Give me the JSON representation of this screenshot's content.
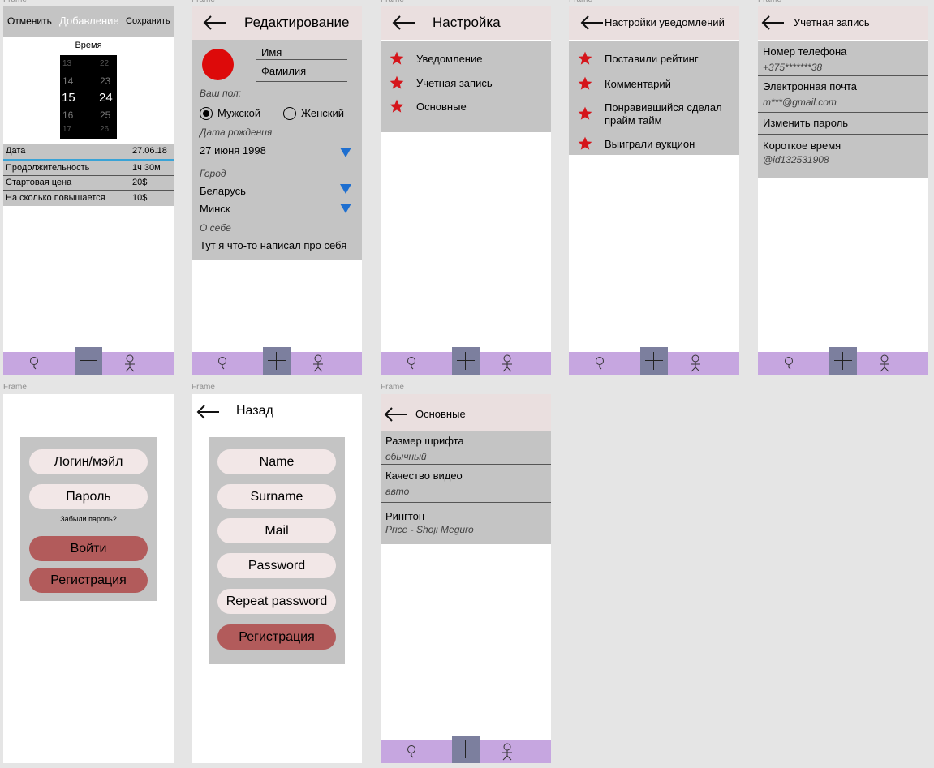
{
  "frame_label": "Frame",
  "add": {
    "cancel": "Отменить",
    "title": "Добавление",
    "save": "Сохранить",
    "time_label": "Время",
    "picker_hours": [
      "13",
      "14",
      "15",
      "16",
      "17"
    ],
    "picker_minutes": [
      "22",
      "23",
      "24",
      "25",
      "26"
    ],
    "rows": [
      {
        "label": "Дата",
        "value": "27.06.18"
      },
      {
        "label": "Продолжительность",
        "value": "1ч 30м"
      },
      {
        "label": "Стартовая цена",
        "value": "20$"
      },
      {
        "label": "На сколько  повышается",
        "value": "10$"
      }
    ]
  },
  "edit": {
    "title": "Редактирование",
    "first_name": "Имя",
    "last_name": "Фамилия",
    "gender_label": "Ваш пол:",
    "male": "Мужской",
    "female": "Женский",
    "birth_label": "Дата рождения",
    "birth_value": "27 июня 1998",
    "city_label": "Город",
    "country": "Беларусь",
    "city": "Минск",
    "about_label": "О себе",
    "about_value": "Тут я что-то написал про себя"
  },
  "settings": {
    "title": "Настройка",
    "items": [
      "Уведомление",
      "Учетная запись",
      "Основные"
    ]
  },
  "notifications": {
    "title": "Настройки уведомлений",
    "items": [
      "Поставили рейтинг",
      "Комментарий",
      "Понравившийся сделал прайм тайм",
      "Выиграли аукцион"
    ]
  },
  "account": {
    "title": "Учетная запись",
    "phone_label": "Номер телефона",
    "phone_value": "+375*******38",
    "email_label": "Электронная почта",
    "email_value": "m***@gmail.com",
    "change_password": "Изменить пароль",
    "short_label": "Короткое время",
    "short_value": "@id132531908"
  },
  "login": {
    "login_field": "Логин/мэйл",
    "password_field": "Пароль",
    "forgot": "Забыли пароль?",
    "login_button": "Войти",
    "register_button": "Регистрация"
  },
  "register": {
    "back": "Назад",
    "name": "Name",
    "surname": "Surname",
    "mail": "Mail",
    "password": "Password",
    "repeat_password": "Repeat password",
    "register_button": "Регистрация"
  },
  "general": {
    "title": "Основные",
    "font_label": "Размер шрифта",
    "font_value": "обычный",
    "video_label": "Качество видео",
    "video_value": "авто",
    "ringtone_label": "Рингтон",
    "ringtone_value": "Price - Shoji Meguro"
  },
  "colors": {
    "canvas": "#e5e5e5",
    "header": "#eadfdf",
    "panel": "#c4c4c4",
    "nav": "#c6a6e0",
    "nav_plus": "#7c7f9e",
    "star": "#d5151b",
    "accent_button": "#b25b5b",
    "dropdown": "#1e6fd0",
    "avatar": "#dd0a0a"
  },
  "icons": {
    "nav": [
      "search-icon",
      "plus-icon",
      "person-icon"
    ],
    "back": "arrow-left-icon",
    "list": "star-icon",
    "select": "triangle-down-icon"
  }
}
